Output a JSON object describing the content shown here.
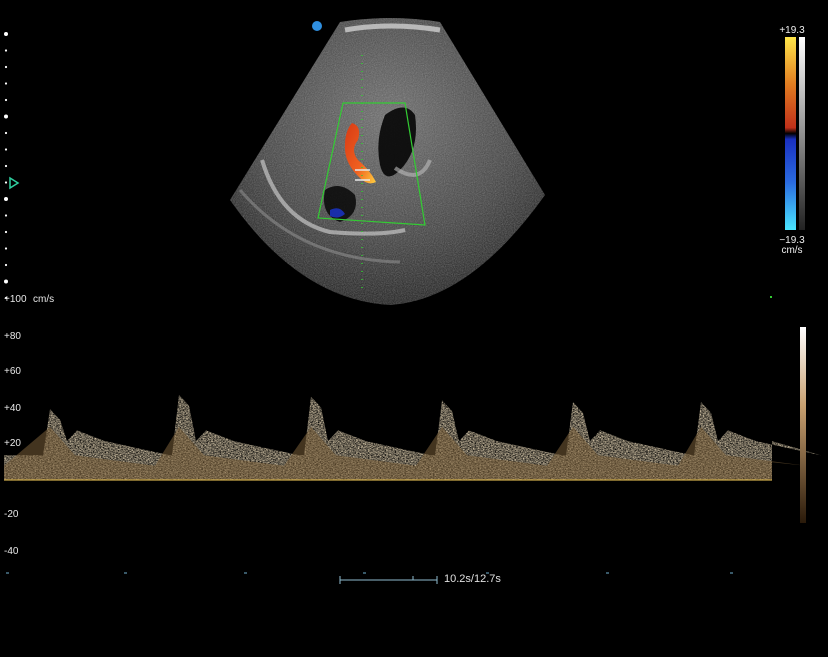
{
  "bmode": {
    "orientation_marker_color": "#2f8fe0"
  },
  "color_scale": {
    "max_label": "+19.3",
    "min_label": "−19.3",
    "unit_label": "cm/s",
    "gradient_top": "#ffe64a",
    "gradient_mid_red": "#c0301a",
    "gradient_mid_blue": "#1a30c0",
    "gradient_bottom": "#4ae6ff"
  },
  "spectral": {
    "velocity_unit": "cm/s",
    "axis_labels": [
      "+100",
      "+80",
      "+60",
      "+40",
      "+20",
      "-20",
      "-40"
    ],
    "baseline_color": "#c9a84a",
    "trace_color": "#c9a678"
  },
  "timeline": {
    "readout": "10.2s/12.7s"
  }
}
